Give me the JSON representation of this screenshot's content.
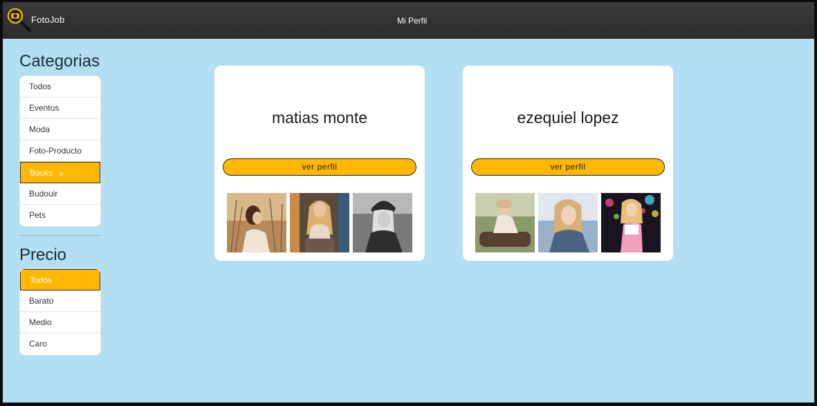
{
  "header": {
    "brand": "FotoJob",
    "profile_link": "Mi Perfil"
  },
  "sidebar": {
    "categories_title": "Categorias",
    "categories": [
      {
        "label": "Todos",
        "active": false
      },
      {
        "label": "Eventos",
        "active": false
      },
      {
        "label": "Moda",
        "active": false
      },
      {
        "label": "Foto-Producto",
        "active": false
      },
      {
        "label": "Books",
        "active": true
      },
      {
        "label": "Budouir",
        "active": false
      },
      {
        "label": "Pets",
        "active": false
      }
    ],
    "price_title": "Precio",
    "prices": [
      {
        "label": "Todos",
        "active": true
      },
      {
        "label": "Barato",
        "active": false
      },
      {
        "label": "Medio",
        "active": false
      },
      {
        "label": "Caro",
        "active": false
      }
    ]
  },
  "colors": {
    "accent": "#ffb700",
    "background": "#b3dff2",
    "topbar": "#333333"
  },
  "photographers": [
    {
      "name": "matias monte",
      "button": "ver perfil"
    },
    {
      "name": "ezequiel lopez",
      "button": "ver perfil"
    }
  ]
}
